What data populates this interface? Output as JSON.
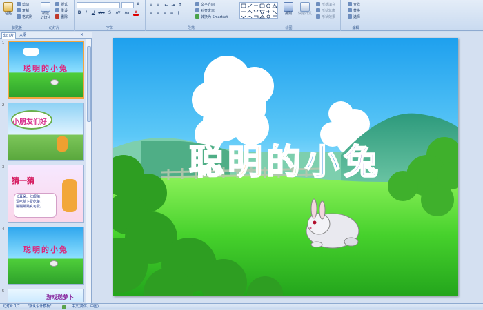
{
  "ribbon": {
    "clipboard": {
      "group_label": "剪贴板",
      "paste": "粘贴",
      "cut": "剪切",
      "copy": "复制",
      "format_painter": "格式刷"
    },
    "slides": {
      "group_label": "幻灯片",
      "new_slide_line1": "新建",
      "new_slide_line2": "幻灯片",
      "layout": "版式",
      "reset": "重设",
      "delete": "删除"
    },
    "font": {
      "group_label": "字体",
      "font_name": "",
      "font_size": "",
      "bold": "B",
      "italic": "I",
      "underline": "U",
      "strike": "abe",
      "shadow": "S",
      "spacing": "AV",
      "case": "Aa",
      "color": "A"
    },
    "paragraph": {
      "group_label": "段落",
      "text_direction": "文字方向",
      "align_text": "对齐文本",
      "smartart": "转换为 SmartArt"
    },
    "drawing": {
      "group_label": "绘图",
      "arrange": "排列",
      "quick_styles": "快速样式",
      "shape_fill": "形状填充",
      "shape_outline": "形状轮廓",
      "shape_effects": "形状效果"
    },
    "editing": {
      "group_label": "编辑",
      "find": "查找",
      "replace": "替换",
      "select": "选择"
    }
  },
  "panel": {
    "tab_slides": "幻灯片",
    "tab_outline": "大纲",
    "thumbnails": [
      {
        "num": "1",
        "title": "聪明的小兔"
      },
      {
        "num": "2",
        "title": "小朋友们好"
      },
      {
        "num": "3",
        "title": "猜一猜",
        "riddle": [
          "长耳朵、红眼睛，",
          "爱吃萝卜爱吃菜，",
          "蹦蹦跳跳真可爱。"
        ]
      },
      {
        "num": "4",
        "title": "聪明的小兔"
      },
      {
        "num": "5",
        "title": "游戏送萝卜"
      }
    ]
  },
  "slide": {
    "title": "聪明的小兔"
  },
  "status": {
    "slide_info": "幻灯片 1/7",
    "theme": "\"默认设计模板\"",
    "language": "中文(简体，中国)"
  },
  "colors": {
    "title_chars": [
      "#e0247a",
      "#ff8a00",
      "#2fae2f",
      "#2b8fd8",
      "#7a3fc8"
    ]
  }
}
